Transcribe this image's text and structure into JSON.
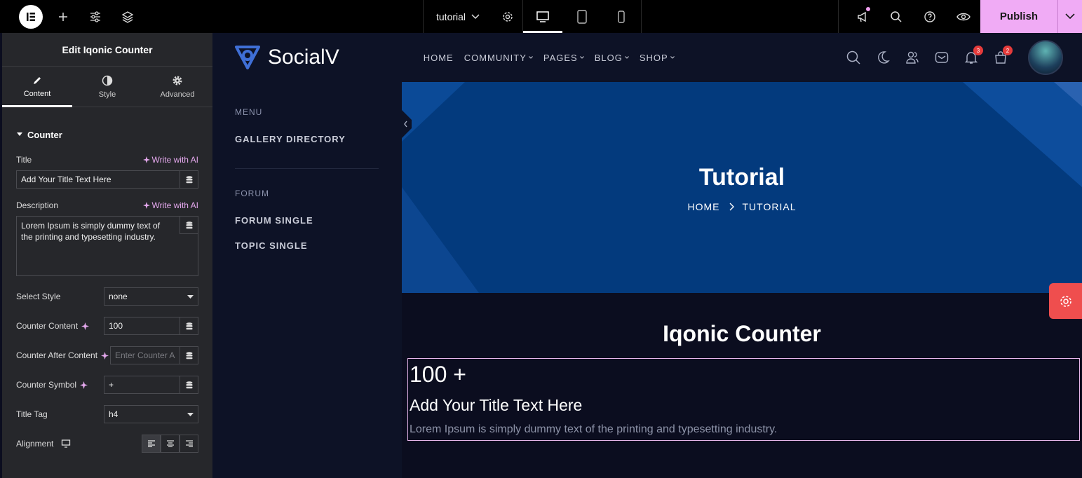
{
  "topbar": {
    "doc_title": "tutorial",
    "publish_label": "Publish"
  },
  "panel": {
    "heading": "Edit Iqonic Counter",
    "tabs": [
      {
        "label": "Content",
        "icon": "pencil-icon"
      },
      {
        "label": "Style",
        "icon": "half-circle-icon"
      },
      {
        "label": "Advanced",
        "icon": "gear-icon"
      }
    ],
    "section": "Counter",
    "ai_label": "Write with AI",
    "title_label": "Title",
    "title_value": "Add Your Title Text Here",
    "description_label": "Description",
    "description_value": "Lorem Ipsum is simply dummy text of the printing and typesetting industry.",
    "select_style_label": "Select Style",
    "select_style_value": "none",
    "counter_content_label": "Counter Content",
    "counter_content_value": "100",
    "counter_after_label": "Counter After Content",
    "counter_after_placeholder": "Enter Counter A",
    "counter_symbol_label": "Counter Symbol",
    "counter_symbol_value": "+",
    "title_tag_label": "Title Tag",
    "title_tag_value": "h4",
    "alignment_label": "Alignment"
  },
  "site": {
    "brand": "SocialV",
    "nav": [
      "HOME",
      "COMMUNITY",
      "PAGES",
      "BLOG",
      "SHOP"
    ],
    "notifications_badge": "3",
    "cart_badge": "2",
    "side_menu": {
      "menu_head": "MENU",
      "menu_items": [
        "GALLERY DIRECTORY"
      ],
      "forum_head": "FORUM",
      "forum_items": [
        "FORUM SINGLE",
        "TOPIC SINGLE"
      ]
    },
    "hero_title": "Tutorial",
    "breadcrumb": [
      "HOME",
      "TUTORIAL"
    ],
    "widget_heading": "Iqonic Counter",
    "counter_value": "100",
    "counter_symbol": "+",
    "counter_title": "Add Your Title Text Here",
    "counter_description": "Lorem Ipsum is simply dummy text of the printing and typesetting industry."
  },
  "colors": {
    "publish_bg": "#f0abf5",
    "hero_bg": "#033a7d",
    "badge": "#e53b3b",
    "float_gear_bg": "#ef4e4e",
    "selection_border": "#e6b6ea"
  }
}
